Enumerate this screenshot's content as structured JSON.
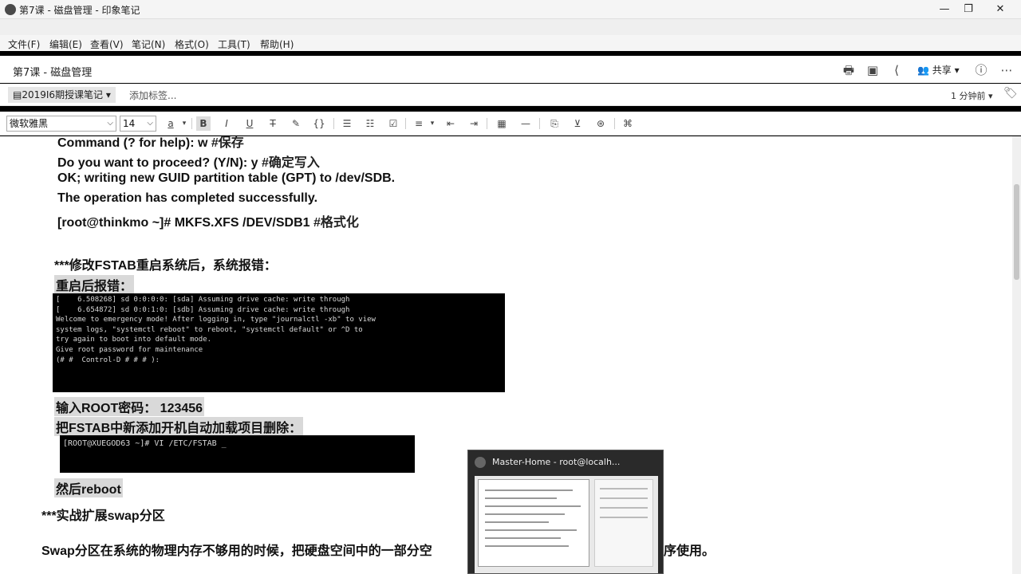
{
  "window": {
    "title": "第7课 - 磁盘管理 - 印象笔记",
    "min": "—",
    "restore": "❐",
    "close": "✕"
  },
  "menu": [
    "文件(F)",
    "编辑(E)",
    "查看(V)",
    "笔记(N)",
    "格式(O)",
    "工具(T)",
    "帮助(H)"
  ],
  "note": {
    "title": "第7课 - 磁盘管理",
    "share_label": "共享",
    "notebook": "2019I6期授课笔记",
    "tag_placeholder": "添加标签...",
    "modified": "1 分钟前"
  },
  "format": {
    "font": "微软雅黑",
    "size": "14"
  },
  "icons": {
    "print": "🖶",
    "present": "▣",
    "share": "⟨",
    "people": "👥",
    "info": "ⓘ",
    "more": "⋯",
    "notebook": "▤",
    "tag": "🏷"
  },
  "content": {
    "line0_cmd": "Command (? for help): w",
    "line0_cmt": "#保存",
    "line1_cmd": "Do you want to proceed? (Y/N): y",
    "line1_cmt": "#确定写入",
    "line2": "OK; writing new GUID partition table (GPT) to /dev/SDB.",
    "line3": "The operation has completed successfully.",
    "line4_cmd": "[root@thinkmo ~]# MKFS.XFS  /DEV/SDB1",
    "line4_cmt": "#格式化",
    "heading1": "***修改FSTAB重启系统后，系统报错：",
    "label_error": "重启后报错：",
    "terminal1": "[    6.508268] sd 0:0:0:0: [sda] Assuming drive cache: write through\n[    6.654872] sd 0:0:1:0: [sdb] Assuming drive cache: write through\nWelcome to emergency mode! After logging in, type \"journalctl -xb\" to view\nsystem logs, \"systemctl reboot\" to reboot, \"systemctl default\" or ^D to\ntry again to boot into default mode.\nGive root password for maintenance\n(# #  Control-D # # # ):",
    "label_root": "输入ROOT密码：  123456",
    "label_delete": "把FSTAB中新添加开机自动加载项目删除：",
    "terminal2": "[ROOT@XUEGOD63 ~]# VI /ETC/FSTAB _",
    "label_reboot": "然后reboot",
    "heading2": "***实战扩展swap分区",
    "line_swap": "Swap分区在系统的物理内存不够用的时候，把硬盘空间中的一部分空",
    "line_swap_end": "序使用。"
  },
  "popup": {
    "title": "Master-Home - root@localh..."
  }
}
